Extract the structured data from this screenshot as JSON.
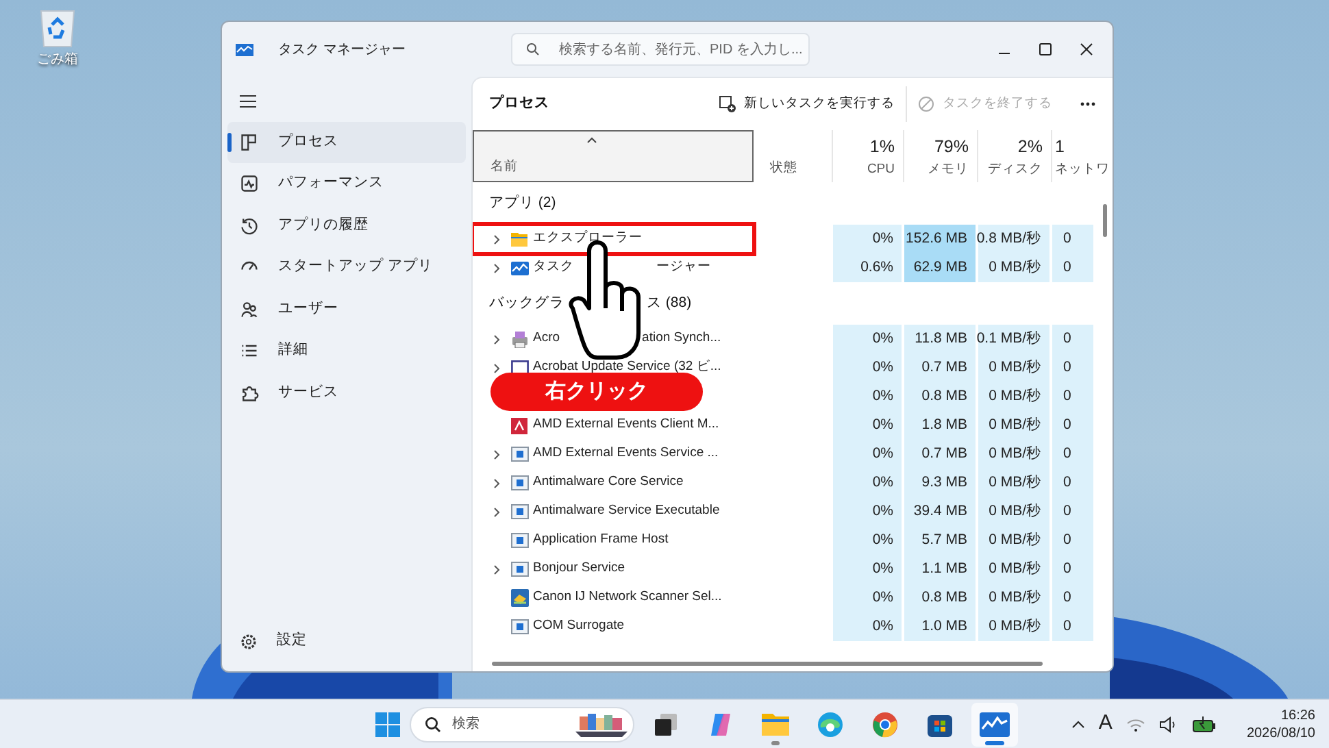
{
  "desktop": {
    "icons": [
      {
        "label": "ごみ箱",
        "kind": "recycle-bin"
      }
    ]
  },
  "window": {
    "title": "タスク マネージャー",
    "search": {
      "placeholder": "検索する名前、発行元、PID を入力し..."
    }
  },
  "sidebar": {
    "items": [
      {
        "label": "プロセス",
        "kind": "processes",
        "selected": true
      },
      {
        "label": "パフォーマンス",
        "kind": "performance",
        "selected": false
      },
      {
        "label": "アプリの履歴",
        "kind": "history",
        "selected": false
      },
      {
        "label": "スタートアップ アプリ",
        "kind": "startup",
        "selected": false
      },
      {
        "label": "ユーザー",
        "kind": "users",
        "selected": false
      },
      {
        "label": "詳細",
        "kind": "details",
        "selected": false
      },
      {
        "label": "サービス",
        "kind": "services",
        "selected": false
      }
    ],
    "footer": {
      "label": "設定"
    }
  },
  "toolbar": {
    "title": "プロセス",
    "actions": [
      {
        "label": "新しいタスクを実行する",
        "kind": "run",
        "disabled": false
      },
      {
        "label": "タスクを終了する",
        "kind": "end",
        "disabled": true
      }
    ]
  },
  "table": {
    "columns": [
      {
        "label": "名前",
        "kind": "name",
        "sorted": true
      },
      {
        "label": "状態",
        "kind": "status",
        "sorted": false
      },
      {
        "label": "CPU",
        "value": "1%",
        "kind": "cpu",
        "sorted": false
      },
      {
        "label": "メモリ",
        "value": "79%",
        "kind": "memory",
        "sorted": false
      },
      {
        "label": "ディスク",
        "value": "2%",
        "kind": "disk",
        "sorted": false
      },
      {
        "label": "ネットワ",
        "value": "1",
        "kind": "network",
        "sorted": false
      }
    ],
    "groups": [
      {
        "title_parts": [
          "アプリ (2)"
        ],
        "rows": [
          {
            "name_parts": [
              "エクスプローラー"
            ],
            "kind": "folder",
            "expandable": true,
            "highlighted": true,
            "cpu": "0%",
            "memory": "152.6 MB",
            "memory_high": true,
            "disk": "0.8 MB/秒",
            "network": "0"
          },
          {
            "name_parts": [
              "タスク",
              "ージャー"
            ],
            "kind": "taskmgr",
            "expandable": true,
            "highlighted": false,
            "cpu": "0.6%",
            "memory": "62.9 MB",
            "memory_high": true,
            "disk": "0 MB/秒",
            "network": "0"
          }
        ]
      },
      {
        "title_parts": [
          "バックグラ",
          "ス (88)"
        ],
        "rows": [
          {
            "name_parts": [
              "Acro",
              "ation Synch..."
            ],
            "kind": "acrobat-sync",
            "expandable": true,
            "highlighted": false,
            "cpu": "0%",
            "memory": "11.8 MB",
            "memory_high": false,
            "disk": "0.1 MB/秒",
            "network": "0"
          },
          {
            "name_parts": [
              "Acrobat Update Service (32 ビ..."
            ],
            "kind": "window",
            "expandable": true,
            "highlighted": false,
            "cpu": "0%",
            "memory": "0.7 MB",
            "memory_high": false,
            "disk": "0 MB/秒",
            "network": "0"
          },
          {
            "name_parts": [],
            "expandable": false,
            "highlighted": false,
            "cpu": "0%",
            "memory": "0.8 MB",
            "memory_high": false,
            "disk": "0 MB/秒",
            "network": "0"
          },
          {
            "name_parts": [
              "AMD External Events Client M..."
            ],
            "kind": "amd",
            "expandable": false,
            "highlighted": false,
            "cpu": "0%",
            "memory": "1.8 MB",
            "memory_high": false,
            "disk": "0 MB/秒",
            "network": "0"
          },
          {
            "name_parts": [
              "AMD External Events Service ..."
            ],
            "kind": "service",
            "expandable": true,
            "highlighted": false,
            "cpu": "0%",
            "memory": "0.7 MB",
            "memory_high": false,
            "disk": "0 MB/秒",
            "network": "0"
          },
          {
            "name_parts": [
              "Antimalware Core Service"
            ],
            "kind": "service",
            "expandable": true,
            "highlighted": false,
            "cpu": "0%",
            "memory": "9.3 MB",
            "memory_high": false,
            "disk": "0 MB/秒",
            "network": "0"
          },
          {
            "name_parts": [
              "Antimalware Service Executable"
            ],
            "kind": "service",
            "expandable": true,
            "highlighted": false,
            "cpu": "0%",
            "memory": "39.4 MB",
            "memory_high": false,
            "disk": "0 MB/秒",
            "network": "0"
          },
          {
            "name_parts": [
              "Application Frame Host"
            ],
            "kind": "service",
            "expandable": false,
            "highlighted": false,
            "cpu": "0%",
            "memory": "5.7 MB",
            "memory_high": false,
            "disk": "0 MB/秒",
            "network": "0"
          },
          {
            "name_parts": [
              "Bonjour Service"
            ],
            "kind": "service",
            "expandable": true,
            "highlighted": false,
            "cpu": "0%",
            "memory": "1.1 MB",
            "memory_high": false,
            "disk": "0 MB/秒",
            "network": "0"
          },
          {
            "name_parts": [
              "Canon IJ Network Scanner Sel..."
            ],
            "kind": "canon",
            "expandable": false,
            "highlighted": false,
            "cpu": "0%",
            "memory": "0.8 MB",
            "memory_high": false,
            "disk": "0 MB/秒",
            "network": "0"
          },
          {
            "name_parts": [
              "COM Surrogate"
            ],
            "kind": "service",
            "expandable": false,
            "highlighted": false,
            "cpu": "0%",
            "memory": "1.0 MB",
            "memory_high": false,
            "disk": "0 MB/秒",
            "network": "0"
          }
        ]
      }
    ]
  },
  "annotation": {
    "label": "右クリック"
  },
  "taskbar": {
    "search": {
      "placeholder": "検索"
    },
    "apps": [
      {
        "kind": "task-view",
        "running": false,
        "active": false
      },
      {
        "kind": "copilot",
        "running": false,
        "active": false
      },
      {
        "kind": "explorer",
        "running": true,
        "active": false
      },
      {
        "kind": "edge",
        "running": false,
        "active": false
      },
      {
        "kind": "chrome",
        "running": false,
        "active": false
      },
      {
        "kind": "store",
        "running": false,
        "active": false
      },
      {
        "kind": "taskmgr",
        "running": true,
        "active": true
      }
    ],
    "tray": {
      "ime": "A",
      "time": "16:26",
      "date": "2026/08/10"
    }
  }
}
